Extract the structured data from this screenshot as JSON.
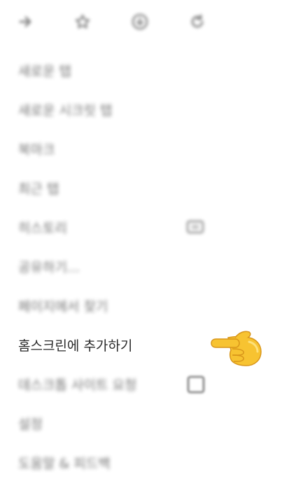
{
  "toolbar": {
    "icons": [
      "forward-arrow-icon",
      "star-icon",
      "download-icon",
      "refresh-icon"
    ]
  },
  "menu": {
    "items": [
      {
        "label": "새로운 탭"
      },
      {
        "label": "새로운 시크릿 탭"
      },
      {
        "label": "북마크"
      },
      {
        "label": "최근 탭"
      },
      {
        "label": "히스토리"
      },
      {
        "label": "공유하기..."
      },
      {
        "label": "페이지에서 찾기"
      },
      {
        "label": "홈스크린에 추가하기"
      },
      {
        "label": "데스크톱 사이트 요청"
      },
      {
        "label": "설정"
      },
      {
        "label": "도움말 & 피드백"
      }
    ]
  },
  "colors": {
    "text": "#3a3a3a",
    "icon": "#5a5a5a",
    "pointer": "#f7c331"
  },
  "highlight": {
    "focused_item": "홈스크린에 추가하기",
    "pointer_icon": "backhand-index-pointing-left-emoji"
  }
}
